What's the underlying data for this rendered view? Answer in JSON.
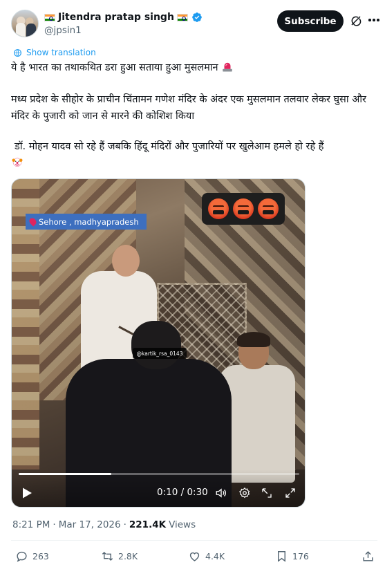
{
  "author": {
    "display_name": "Jitendra pratap singh",
    "handle": "@jpsin1",
    "verified": true
  },
  "header": {
    "subscribe_label": "Subscribe",
    "icons": [
      "grok-icon",
      "more-icon"
    ]
  },
  "translate": {
    "label": "Show translation"
  },
  "tweet": {
    "line1": "ये है भारत का तथाकथित डरा हुआ सताया हुआ मुसलमान",
    "line2": "मध्य प्रदेश के सीहोर के प्राचीन चिंतामन गणेश मंदिर के अंदर एक मुसलमान तलवार लेकर घुसा और मंदिर के पुजारी को जान से मारने की कोशिश किया",
    "line3": "डॉ. मोहन यादव    सो रहे हैं जबकि हिंदू मंदिरों और पुजारियों पर खुलेआम हमले हो रहे हैं",
    "emojis": [
      "siren-emoji",
      "clown-emoji"
    ]
  },
  "video": {
    "location_tag": "Sehore , madhyapradesh",
    "watermark": "@kartik_rsa_0143",
    "overlay_emojis": [
      "angry-emoji",
      "angry-emoji",
      "angry-emoji"
    ],
    "current_time": "0:10",
    "duration": "0:30",
    "time_display": "0:10 / 0:30",
    "progress": 0.33
  },
  "meta": {
    "time": "8:21 PM",
    "separator": "·",
    "date": "Mar 17, 2026",
    "views_count": "221.4K",
    "views_label": "Views"
  },
  "actions": {
    "replies": "263",
    "reposts": "2.8K",
    "likes": "4.4K",
    "bookmarks": "176"
  },
  "colors": {
    "accent": "#1d9bf0",
    "text_primary": "#0f1419",
    "text_secondary": "#536471",
    "location_tag_bg": "#3d6fbf"
  }
}
